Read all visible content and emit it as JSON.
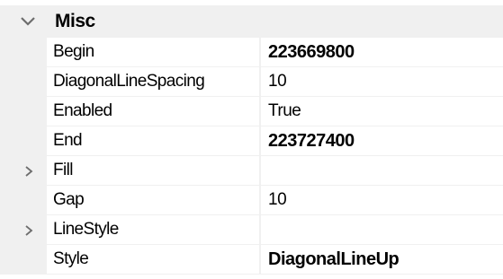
{
  "category": {
    "label": "Misc",
    "icon": "chevron-down-icon",
    "expanded": true
  },
  "properties": [
    {
      "name": "Begin",
      "value": "223669800",
      "bold": true,
      "expandable": false
    },
    {
      "name": "DiagonalLineSpacing",
      "value": "10",
      "bold": false,
      "expandable": false
    },
    {
      "name": "Enabled",
      "value": "True",
      "bold": false,
      "expandable": false
    },
    {
      "name": "End",
      "value": "223727400",
      "bold": true,
      "expandable": false
    },
    {
      "name": "Fill",
      "value": "",
      "bold": false,
      "expandable": true
    },
    {
      "name": "Gap",
      "value": "10",
      "bold": false,
      "expandable": false
    },
    {
      "name": "LineStyle",
      "value": "",
      "bold": false,
      "expandable": true
    },
    {
      "name": "Style",
      "value": "DiagonalLineUp",
      "bold": true,
      "expandable": false
    }
  ],
  "colors": {
    "gutter": "#f0f0f0",
    "chevron": "#6d6d6d",
    "text": "#000000",
    "background": "#ffffff"
  }
}
